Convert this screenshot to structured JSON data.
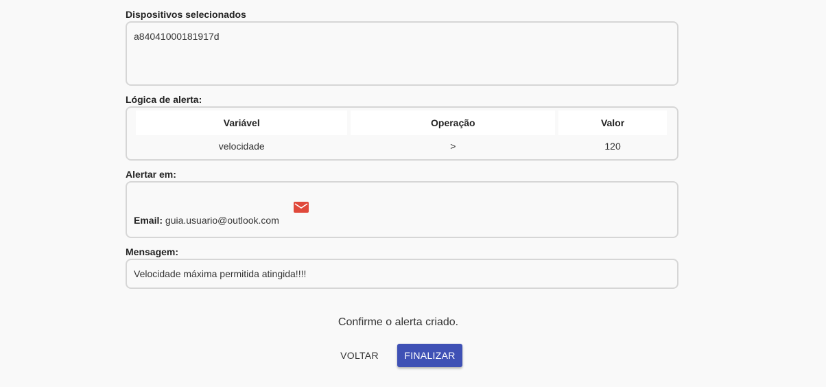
{
  "devices": {
    "label": "Dispositivos selecionados",
    "value": "a84041000181917d"
  },
  "logic": {
    "label": "Lógica de alerta:",
    "headers": [
      "Variável",
      "Operação",
      "Valor"
    ],
    "rows": [
      [
        "velocidade",
        ">",
        "120"
      ]
    ]
  },
  "alert_in": {
    "label": "Alertar em:",
    "icon": "email-icon",
    "icon_color": "#e0493b",
    "email_label": "Email:",
    "email_value": "guia.usuario@outlook.com"
  },
  "message": {
    "label": "Mensagem:",
    "value": "Velocidade máxima permitida atingida!!!!"
  },
  "footer": {
    "confirm_text": "Confirme o alerta criado.",
    "back_label": "VOLTAR",
    "finish_label": "FINALIZAR",
    "accent_color": "#3f51b5"
  }
}
